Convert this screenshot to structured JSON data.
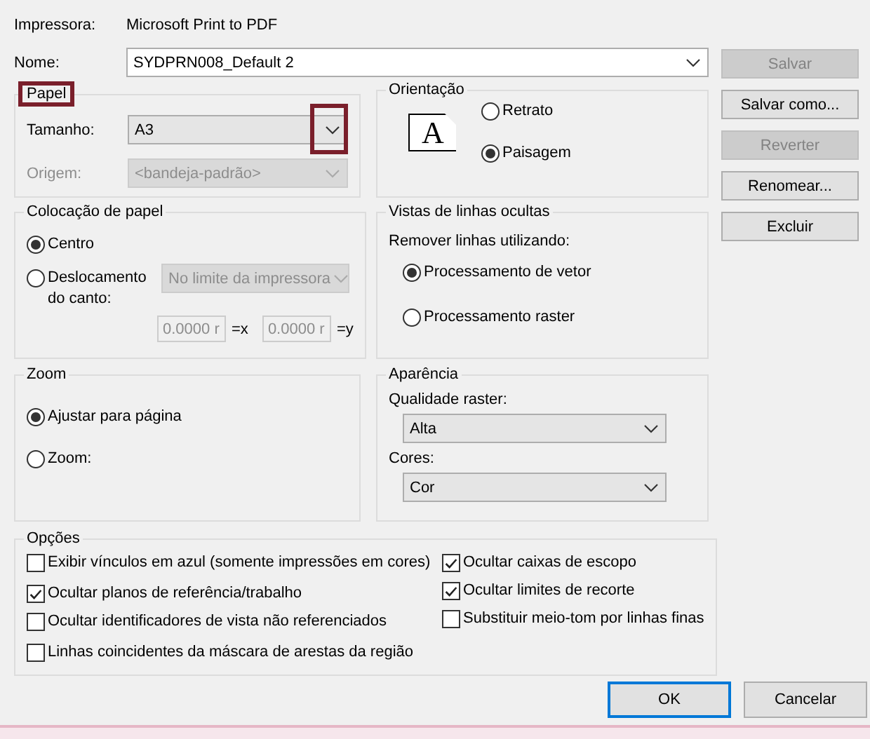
{
  "printer": {
    "label": "Impressora:",
    "value": "Microsoft Print to PDF"
  },
  "name": {
    "label": "Nome:",
    "value": "SYDPRN008_Default 2"
  },
  "paper": {
    "title": "Papel",
    "highlighted": true,
    "size": {
      "label": "Tamanho:",
      "value": "A3",
      "disabled": false,
      "arrow_highlighted": true
    },
    "source": {
      "label": "Origem:",
      "value": "<bandeja-padrão>",
      "disabled": true
    }
  },
  "orientation": {
    "title": "Orientação",
    "icon_text": "A",
    "options": [
      {
        "label": "Retrato",
        "selected": false
      },
      {
        "label": "Paisagem",
        "selected": true
      }
    ]
  },
  "placement": {
    "title": "Colocação de papel",
    "options": [
      {
        "label": "Centro",
        "selected": true
      },
      {
        "label": "Deslocamento do canto:",
        "selected": false
      }
    ],
    "offset_mode": {
      "value": "No limite da impressora",
      "disabled": true
    },
    "x": {
      "value": "0.0000 r",
      "suffix": "=x",
      "disabled": true
    },
    "y": {
      "value": "0.0000 r",
      "suffix": "=y",
      "disabled": true
    }
  },
  "hidden_lines": {
    "title": "Vistas de linhas ocultas",
    "label": "Remover linhas utilizando:",
    "options": [
      {
        "label": "Processamento de vetor",
        "selected": true
      },
      {
        "label": "Processamento raster",
        "selected": false
      }
    ]
  },
  "zoom": {
    "title": "Zoom",
    "options": [
      {
        "label": "Ajustar para página",
        "selected": true
      },
      {
        "label": "Zoom:",
        "selected": false
      }
    ]
  },
  "appearance": {
    "title": "Aparência",
    "raster_quality": {
      "label": "Qualidade raster:",
      "value": "Alta",
      "disabled": false
    },
    "colors": {
      "label": "Cores:",
      "value": "Cor",
      "disabled": false
    }
  },
  "options": {
    "title": "Opções",
    "columns": [
      {
        "items": [
          {
            "label": "Exibir vínculos em azul (somente impressões em cores)",
            "checked": false
          },
          {
            "label": "Ocultar planos de referência/trabalho",
            "checked": true
          },
          {
            "label": "Ocultar identificadores de vista não referenciados",
            "checked": false
          },
          {
            "label": "Linhas coincidentes da máscara de arestas da região",
            "checked": false
          }
        ]
      },
      {
        "items": [
          {
            "label": "Ocultar caixas de escopo",
            "checked": true
          },
          {
            "label": "Ocultar limites de recorte",
            "checked": true
          },
          {
            "label": "Substituir meio-tom por linhas finas",
            "checked": false
          }
        ]
      }
    ]
  },
  "side_buttons": [
    {
      "label": "Salvar",
      "disabled": true
    },
    {
      "label": "Salvar como...",
      "disabled": false
    },
    {
      "label": "Reverter",
      "disabled": true
    },
    {
      "label": "Renomear...",
      "disabled": false
    },
    {
      "label": "Excluir",
      "disabled": false
    }
  ],
  "footer_buttons": [
    {
      "label": "OK",
      "default": true
    },
    {
      "label": "Cancelar",
      "default": false
    }
  ]
}
